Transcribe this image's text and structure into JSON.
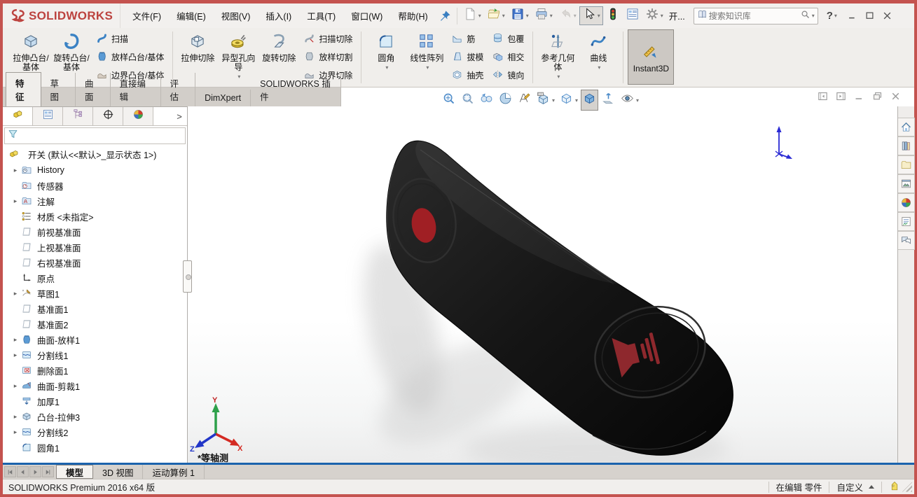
{
  "window": {
    "frame_color": "#c4534f",
    "logo_text": "SOLIDWORKS"
  },
  "menubar": {
    "items": [
      "文件(F)",
      "编辑(E)",
      "视图(V)",
      "插入(I)",
      "工具(T)",
      "窗口(W)",
      "帮助(H)"
    ]
  },
  "quickbar": {
    "items": [
      {
        "id": "new-document",
        "caret": true
      },
      {
        "id": "open-document",
        "caret": true
      },
      {
        "id": "save-document",
        "caret": true
      },
      {
        "id": "print-document",
        "caret": true
      },
      {
        "id": "undo",
        "caret": true,
        "disabled": true
      },
      {
        "id": "select-cursor",
        "caret": true,
        "pressed": true
      },
      {
        "id": "rebuild-traffic-light",
        "caret": false
      },
      {
        "id": "options-list",
        "caret": false
      },
      {
        "id": "settings-gear",
        "caret": true
      }
    ],
    "overflow_label": "开...",
    "search_placeholder": "搜索知识库",
    "help_label": "?"
  },
  "ribbon": {
    "groups": [
      {
        "big": [
          {
            "id": "extrude-boss-base",
            "label": "拉伸凸台/基体",
            "icon": "boss-extrude"
          },
          {
            "id": "revolve-boss-base",
            "label": "旋转凸台/基体",
            "icon": "revolve-boss"
          }
        ],
        "stacks": [
          [
            {
              "id": "sweep",
              "label": "扫描",
              "icon": "sweep"
            },
            {
              "id": "loft-boss-base",
              "label": "放样凸台/基体",
              "icon": "loft"
            },
            {
              "id": "boundary-boss-base",
              "label": "边界凸台/基体",
              "icon": "boundary"
            }
          ]
        ]
      },
      {
        "big": [
          {
            "id": "extrude-cut",
            "label": "拉伸切除",
            "icon": "extrude-cut"
          },
          {
            "id": "hole-wizard",
            "label": "异型孔向导",
            "icon": "hole-wizard",
            "caret": true
          },
          {
            "id": "revolve-cut",
            "label": "旋转切除",
            "icon": "revolve-cut"
          }
        ],
        "stacks": [
          [
            {
              "id": "sweep-cut",
              "label": "扫描切除",
              "icon": "sweep-cut"
            },
            {
              "id": "loft-cut",
              "label": "放样切割",
              "icon": "loft-cut"
            },
            {
              "id": "boundary-cut",
              "label": "边界切除",
              "icon": "boundary-cut"
            }
          ]
        ]
      },
      {
        "big": [
          {
            "id": "fillet",
            "label": "圆角",
            "icon": "fillet",
            "caret": true
          },
          {
            "id": "linear-pattern",
            "label": "线性阵列",
            "icon": "linear-pattern",
            "caret": true
          }
        ],
        "stacks": [
          [
            {
              "id": "rib",
              "label": "筋",
              "icon": "rib"
            },
            {
              "id": "draft",
              "label": "拔模",
              "icon": "draft"
            },
            {
              "id": "shell",
              "label": "抽壳",
              "icon": "shell"
            }
          ],
          [
            {
              "id": "wrap",
              "label": "包覆",
              "icon": "wrap"
            },
            {
              "id": "intersect",
              "label": "相交",
              "icon": "intersect"
            },
            {
              "id": "mirror",
              "label": "镜向",
              "icon": "mirror"
            }
          ]
        ]
      },
      {
        "big": [
          {
            "id": "reference-geometry",
            "label": "参考几何体",
            "icon": "reference-geometry",
            "caret": true
          },
          {
            "id": "curves",
            "label": "曲线",
            "icon": "curves",
            "caret": true
          }
        ],
        "stacks": []
      },
      {
        "big": [
          {
            "id": "instant3d",
            "label": "Instant3D",
            "icon": "instant3d",
            "active": true
          }
        ],
        "stacks": []
      }
    ]
  },
  "command_tabs": {
    "active_index": 0,
    "items": [
      "特征",
      "草图",
      "曲面",
      "直接编辑",
      "评估",
      "DimXpert",
      "SOLIDWORKS 插件"
    ]
  },
  "headsup": {
    "items": [
      {
        "id": "zoom-to-fit"
      },
      {
        "id": "zoom-to-area"
      },
      {
        "id": "previous-view"
      },
      {
        "id": "section-view"
      },
      {
        "id": "dynamic-annotation-views"
      },
      {
        "id": "apply-scene",
        "caret": true
      },
      {
        "id": "view-orientation",
        "caret": true
      },
      {
        "id": "display-style",
        "pressed": true
      },
      {
        "id": "view-settings"
      },
      {
        "id": "hide-show-items",
        "caret": true
      }
    ]
  },
  "document_controls": {
    "items": [
      "collapse-pane-left",
      "collapse-pane-right",
      "minimize-document",
      "restore-document",
      "close-document"
    ]
  },
  "feature_panel": {
    "tabs": [
      {
        "id": "featuremanager-tree",
        "icon": "part",
        "active": true
      },
      {
        "id": "propertymanager",
        "icon": "pm-list"
      },
      {
        "id": "configurationmanager",
        "icon": "config"
      },
      {
        "id": "dimxpertmanager",
        "icon": "dimxpert"
      },
      {
        "id": "displaymanager",
        "icon": "display-sphere"
      }
    ],
    "expand_arrow": ">",
    "root": {
      "label": "开关 (默认<<默认>_显示状态 1>)",
      "icon": "part"
    },
    "items": [
      {
        "id": "history",
        "label": "History",
        "icon": "history-folder",
        "expandable": true
      },
      {
        "id": "sensors",
        "label": "传感器",
        "icon": "sensors-folder"
      },
      {
        "id": "annotations",
        "label": "注解",
        "icon": "annotations-folder",
        "expandable": true
      },
      {
        "id": "material",
        "label": "材质 <未指定>",
        "icon": "material"
      },
      {
        "id": "front-plane",
        "label": "前视基准面",
        "icon": "plane"
      },
      {
        "id": "top-plane",
        "label": "上视基准面",
        "icon": "plane"
      },
      {
        "id": "right-plane",
        "label": "右视基准面",
        "icon": "plane"
      },
      {
        "id": "origin",
        "label": "原点",
        "icon": "origin"
      },
      {
        "id": "sketch1",
        "label": "草图1",
        "icon": "sketch",
        "expandable": true
      },
      {
        "id": "plane1",
        "label": "基准面1",
        "icon": "plane"
      },
      {
        "id": "plane2",
        "label": "基准面2",
        "icon": "plane"
      },
      {
        "id": "surface-loft1",
        "label": "曲面-放样1",
        "icon": "surface-loft",
        "expandable": true
      },
      {
        "id": "split-line1",
        "label": "分割线1",
        "icon": "split-line",
        "expandable": true
      },
      {
        "id": "delete-face1",
        "label": "删除面1",
        "icon": "delete-face"
      },
      {
        "id": "surface-trim1",
        "label": "曲面-剪裁1",
        "icon": "surface-trim",
        "expandable": true
      },
      {
        "id": "thicken1",
        "label": "加厚1",
        "icon": "thicken"
      },
      {
        "id": "boss-extrude3",
        "label": "凸台-拉伸3",
        "icon": "boss-extrude",
        "expandable": true
      },
      {
        "id": "split-line2",
        "label": "分割线2",
        "icon": "split-line",
        "expandable": true
      },
      {
        "id": "fillet1",
        "label": "圆角1",
        "icon": "fillet"
      }
    ]
  },
  "viewport": {
    "view_label": "*等轴测",
    "triad": {
      "x": "X",
      "y": "Y",
      "z": "Z"
    },
    "part_body_color": "#161616",
    "part_accent_color": "#9e2227"
  },
  "task_pane": {
    "items": [
      "home",
      "design-library",
      "file-explorer",
      "view-palette",
      "appearances-scenes",
      "custom-properties",
      "forum"
    ]
  },
  "bottom_tabs": {
    "active_index": 0,
    "nav": [
      "first",
      "prev",
      "next",
      "last"
    ],
    "items": [
      "模型",
      "3D 视图",
      "运动算例 1"
    ]
  },
  "status_bar": {
    "left": "SOLIDWORKS Premium 2016 x64 版",
    "editing_label": "在编辑 零件",
    "custom_label": "自定义"
  }
}
